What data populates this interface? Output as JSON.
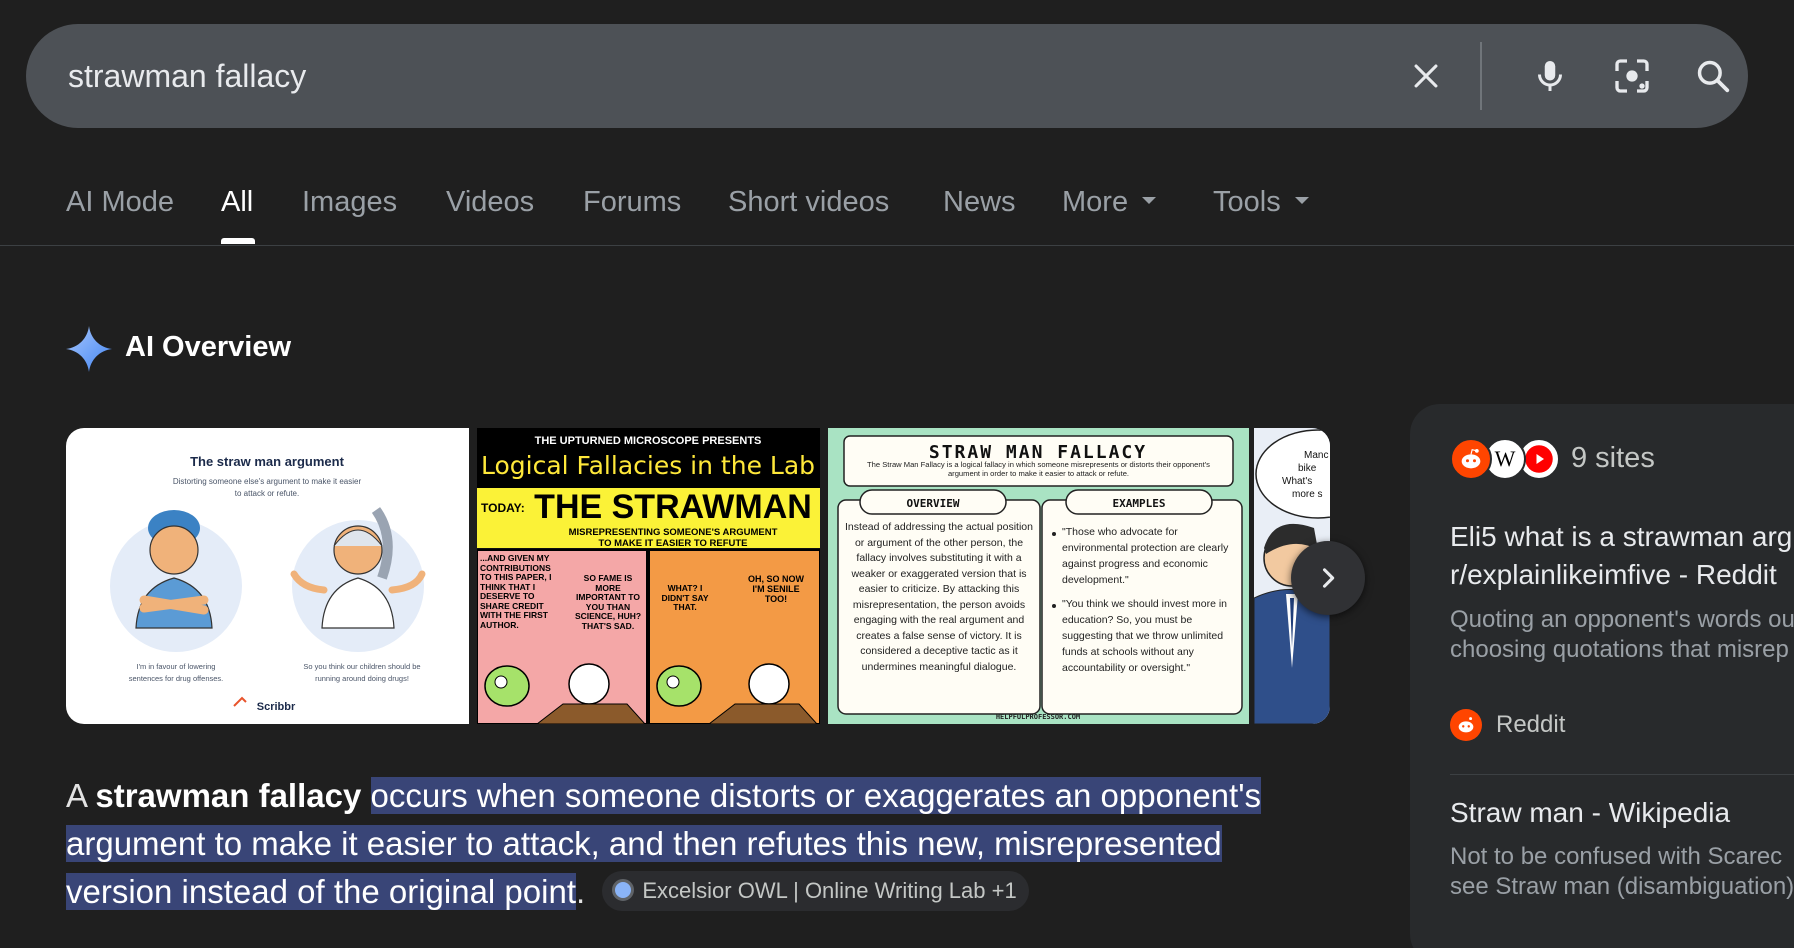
{
  "search": {
    "query": "strawman fallacy",
    "clear_label": "Clear",
    "voice_label": "Search by voice",
    "lens_label": "Search by image",
    "submit_label": "Search"
  },
  "tabs": [
    {
      "label": "AI Mode"
    },
    {
      "label": "All",
      "active": true
    },
    {
      "label": "Images"
    },
    {
      "label": "Videos"
    },
    {
      "label": "Forums"
    },
    {
      "label": "Short videos"
    },
    {
      "label": "News"
    },
    {
      "label": "More",
      "dropdown": true
    },
    {
      "label": "Tools",
      "dropdown": true
    }
  ],
  "ai_overview": {
    "title": "AI Overview",
    "images": [
      {
        "title": "The straw man argument",
        "subtitle_1": "Distorting someone else's argument to make it easier",
        "subtitle_2": "to attack or refute.",
        "caption_left_1": "I'm in favour of lowering",
        "caption_left_2": "sentences for drug offenses.",
        "caption_right_1": "So you think our children should be",
        "caption_right_2": "running around doing drugs!",
        "brand": "Scribbr"
      },
      {
        "kicker": "THE UPTURNED MICROSCOPE PRESENTS",
        "title": "Logical Fallacies in the Lab",
        "today": "TODAY:",
        "headline": "THE STRAWMAN",
        "sub_1": "MISREPRESENTING SOMEONE'S ARGUMENT",
        "sub_2": "TO MAKE IT EASIER TO REFUTE",
        "bubble_1": "...AND GIVEN MY CONTRIBUTIONS TO THIS PAPER, I THINK THAT I DESERVE TO SHARE CREDIT WITH THE FIRST AUTHOR.",
        "bubble_2": "SO FAME IS MORE IMPORTANT TO YOU THAN SCIENCE, HUH? THAT'S SAD.",
        "bubble_3": "WHAT? I DIDN'T SAY THAT.",
        "bubble_4": "OH, SO NOW I'M SENILE TOO!"
      },
      {
        "title": "STRAW MAN FALLACY",
        "definition": "The Straw Man Fallacy is a logical fallacy in which someone misrepresents or distorts their opponent's argument in order to make it easier to attack or refute.",
        "overview_heading": "OVERVIEW",
        "overview_text": "Instead of addressing the actual position or argument of the other person, the fallacy involves substituting it with a weaker or exaggerated version that is easier to criticize. By attacking this misrepresentation, the person avoids engaging with the real argument and creates a false sense of victory. It is considered a deceptive tactic as it undermines meaningful dialogue.",
        "examples_heading": "EXAMPLES",
        "example_1": "\"Those who advocate for environmental protection are clearly against progress and economic development.\"",
        "example_2": "\"You think we should invest more in education? So, you must be suggesting that we throw unlimited funds at schools without any accountability or oversight.\"",
        "footer": "HELPFULPROFESSOR.COM"
      },
      {
        "bubble_1": "Manc",
        "bubble_2": "bike",
        "bubble_3": "What's",
        "bubble_4": "more s"
      }
    ],
    "next_label": "Next",
    "answer_prefix": "A ",
    "answer_term": "strawman fallacy",
    "answer_highlight_1": "occurs when someone distorts or exaggerates an opponent's",
    "answer_highlight_2": "argument to make it easier to attack, and then refutes this new, misrepresented",
    "answer_highlight_3": "version instead of the original point",
    "answer_period": ".",
    "source_chip": "Excelsior OWL | Online Writing Lab +1"
  },
  "sources_panel": {
    "count_label": "9 sites",
    "icons": [
      "reddit-icon",
      "wikipedia-icon",
      "youtube-icon"
    ],
    "results": [
      {
        "title_1": "Eli5 what is a strawman arg",
        "title_2": "r/explainlikeimfive - Reddit",
        "snippet_1": "Quoting an opponent's words ou",
        "snippet_2": "choosing quotations that misrep",
        "source": "Reddit"
      },
      {
        "title_1": "Straw man - Wikipedia",
        "snippet_1": "Not to be confused with Scarec",
        "snippet_2": "see Straw man (disambiguation)"
      }
    ]
  },
  "colors": {
    "background": "#1f1f1f",
    "searchbar": "#4d5156",
    "highlight": "#394577",
    "panel": "#282a2c",
    "ai_star": "#8ab4f8"
  }
}
